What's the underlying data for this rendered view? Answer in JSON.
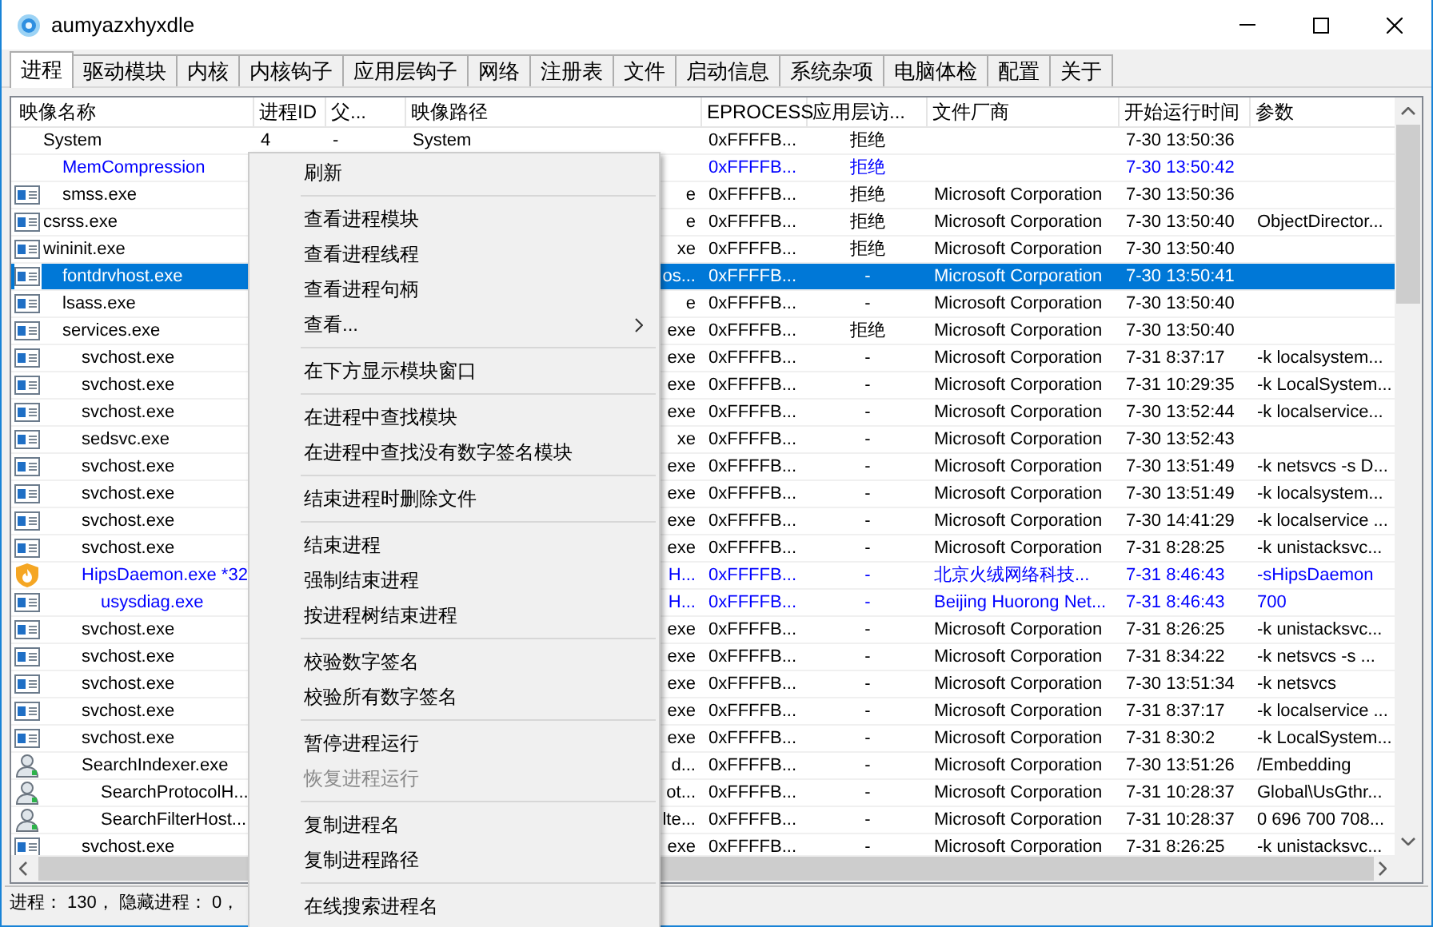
{
  "window": {
    "title": "aumyazxhyxdle"
  },
  "tabs": [
    {
      "label": "进程",
      "selected": true
    },
    {
      "label": "驱动模块",
      "selected": false
    },
    {
      "label": "内核",
      "selected": false
    },
    {
      "label": "内核钩子",
      "selected": false
    },
    {
      "label": "应用层钩子",
      "selected": false
    },
    {
      "label": "网络",
      "selected": false
    },
    {
      "label": "注册表",
      "selected": false
    },
    {
      "label": "文件",
      "selected": false
    },
    {
      "label": "启动信息",
      "selected": false
    },
    {
      "label": "系统杂项",
      "selected": false
    },
    {
      "label": "电脑体检",
      "selected": false
    },
    {
      "label": "配置",
      "selected": false
    },
    {
      "label": "关于",
      "selected": false
    }
  ],
  "table": {
    "columns": [
      "映像名称",
      "进程ID",
      "父...",
      "映像路径",
      "EPROCESS",
      "应用层访...",
      "文件厂商",
      "开始运行时间",
      "参数"
    ],
    "rows": [
      {
        "name": "System",
        "kind": "none",
        "flagged": false,
        "selected": false,
        "pid": "4",
        "parent": "-",
        "path": "System",
        "eprocess": "0xFFFFB...",
        "access": "拒绝",
        "start_time": "7-30 13:50:36",
        "children": [
          {
            "name": "MemCompression",
            "kind": "none",
            "flagged": true,
            "selected": false,
            "eprocess": "0xFFFFB...",
            "access": "拒绝",
            "start_time": "7-30 13:50:42"
          },
          {
            "name": "smss.exe",
            "kind": "window",
            "flagged": false,
            "selected": false,
            "path_tail": "e",
            "eprocess": "0xFFFFB...",
            "access": "拒绝",
            "vendor": "Microsoft Corporation",
            "start_time": "7-30 13:50:36"
          }
        ]
      },
      {
        "name": "csrss.exe",
        "kind": "window",
        "flagged": false,
        "selected": false,
        "path_tail": "e",
        "eprocess": "0xFFFFB...",
        "access": "拒绝",
        "vendor": "Microsoft Corporation",
        "start_time": "7-30 13:50:40",
        "args": "ObjectDirector..."
      },
      {
        "name": "wininit.exe",
        "kind": "window",
        "flagged": false,
        "selected": false,
        "path_tail": "xe",
        "eprocess": "0xFFFFB...",
        "access": "拒绝",
        "vendor": "Microsoft Corporation",
        "start_time": "7-30 13:50:40",
        "children": [
          {
            "name": "fontdrvhost.exe",
            "kind": "window",
            "flagged": false,
            "selected": true,
            "path_tail": "os...",
            "eprocess": "0xFFFFB...",
            "access": "-",
            "vendor": "Microsoft Corporation",
            "start_time": "7-30 13:50:41"
          },
          {
            "name": "lsass.exe",
            "kind": "window",
            "flagged": false,
            "selected": false,
            "path_tail": "e",
            "eprocess": "0xFFFFB...",
            "access": "-",
            "vendor": "Microsoft Corporation",
            "start_time": "7-30 13:50:40"
          },
          {
            "name": "services.exe",
            "kind": "window",
            "flagged": false,
            "selected": false,
            "path_tail": "exe",
            "eprocess": "0xFFFFB...",
            "access": "拒绝",
            "vendor": "Microsoft Corporation",
            "start_time": "7-30 13:50:40",
            "children": [
              {
                "name": "svchost.exe",
                "kind": "window",
                "flagged": false,
                "selected": false,
                "path_tail": "exe",
                "eprocess": "0xFFFFB...",
                "access": "-",
                "vendor": "Microsoft Corporation",
                "start_time": "7-31 8:37:17",
                "args": "-k localsystem..."
              },
              {
                "name": "svchost.exe",
                "kind": "window",
                "flagged": false,
                "selected": false,
                "path_tail": "exe",
                "eprocess": "0xFFFFB...",
                "access": "-",
                "vendor": "Microsoft Corporation",
                "start_time": "7-31 10:29:35",
                "args": "-k LocalSystem..."
              },
              {
                "name": "svchost.exe",
                "kind": "window",
                "flagged": false,
                "selected": false,
                "path_tail": "exe",
                "eprocess": "0xFFFFB...",
                "access": "-",
                "vendor": "Microsoft Corporation",
                "start_time": "7-30 13:52:44",
                "args": "-k localservice..."
              },
              {
                "name": "sedsvc.exe",
                "kind": "window",
                "flagged": false,
                "selected": false,
                "path_tail": "xe",
                "eprocess": "0xFFFFB...",
                "access": "-",
                "vendor": "Microsoft Corporation",
                "start_time": "7-30 13:52:43"
              },
              {
                "name": "svchost.exe",
                "kind": "window",
                "flagged": false,
                "selected": false,
                "path_tail": "exe",
                "eprocess": "0xFFFFB...",
                "access": "-",
                "vendor": "Microsoft Corporation",
                "start_time": "7-30 13:51:49",
                "args": "-k netsvcs -s D..."
              },
              {
                "name": "svchost.exe",
                "kind": "window",
                "flagged": false,
                "selected": false,
                "path_tail": "exe",
                "eprocess": "0xFFFFB...",
                "access": "-",
                "vendor": "Microsoft Corporation",
                "start_time": "7-30 13:51:49",
                "args": "-k localsystem..."
              },
              {
                "name": "svchost.exe",
                "kind": "window",
                "flagged": false,
                "selected": false,
                "path_tail": "exe",
                "eprocess": "0xFFFFB...",
                "access": "-",
                "vendor": "Microsoft Corporation",
                "start_time": "7-30 14:41:29",
                "args": "-k localservice ..."
              },
              {
                "name": "svchost.exe",
                "kind": "window",
                "flagged": false,
                "selected": false,
                "path_tail": "exe",
                "eprocess": "0xFFFFB...",
                "access": "-",
                "vendor": "Microsoft Corporation",
                "start_time": "7-31 8:28:25",
                "args": "-k unistacksvc..."
              },
              {
                "name": "HipsDaemon.exe *32",
                "kind": "shield",
                "flagged": true,
                "selected": false,
                "path_tail": "H...",
                "eprocess": "0xFFFFB...",
                "access": "-",
                "vendor": "北京火绒网络科技...",
                "start_time": "7-31 8:46:43",
                "args": "-sHipsDaemon",
                "children": [
                  {
                    "name": "usysdiag.exe",
                    "kind": "window",
                    "flagged": true,
                    "selected": false,
                    "path_tail": "H...",
                    "eprocess": "0xFFFFB...",
                    "access": "-",
                    "vendor": "Beijing Huorong Net...",
                    "start_time": "7-31 8:46:43",
                    "args": "700"
                  }
                ]
              },
              {
                "name": "svchost.exe",
                "kind": "window",
                "flagged": false,
                "selected": false,
                "path_tail": "exe",
                "eprocess": "0xFFFFB...",
                "access": "-",
                "vendor": "Microsoft Corporation",
                "start_time": "7-31 8:26:25",
                "args": "-k unistacksvc..."
              },
              {
                "name": "svchost.exe",
                "kind": "window",
                "flagged": false,
                "selected": false,
                "path_tail": "exe",
                "eprocess": "0xFFFFB...",
                "access": "-",
                "vendor": "Microsoft Corporation",
                "start_time": "7-31 8:34:22",
                "args": "-k netsvcs -s ..."
              },
              {
                "name": "svchost.exe",
                "kind": "window",
                "flagged": false,
                "selected": false,
                "path_tail": "exe",
                "eprocess": "0xFFFFB...",
                "access": "-",
                "vendor": "Microsoft Corporation",
                "start_time": "7-30 13:51:34",
                "args": "-k netsvcs"
              },
              {
                "name": "svchost.exe",
                "kind": "window",
                "flagged": false,
                "selected": false,
                "path_tail": "exe",
                "eprocess": "0xFFFFB...",
                "access": "-",
                "vendor": "Microsoft Corporation",
                "start_time": "7-31 8:37:17",
                "args": "-k localservice ..."
              },
              {
                "name": "svchost.exe",
                "kind": "window",
                "flagged": false,
                "selected": false,
                "path_tail": "exe",
                "eprocess": "0xFFFFB...",
                "access": "-",
                "vendor": "Microsoft Corporation",
                "start_time": "7-31 8:30:2",
                "args": "-k LocalSystem..."
              },
              {
                "name": "SearchIndexer.exe",
                "kind": "search",
                "flagged": false,
                "selected": false,
                "path_tail": "d...",
                "eprocess": "0xFFFFB...",
                "access": "-",
                "vendor": "Microsoft Corporation",
                "start_time": "7-30 13:51:26",
                "args": "/Embedding",
                "children": [
                  {
                    "name": "SearchProtocolH...",
                    "kind": "search",
                    "flagged": false,
                    "selected": false,
                    "path_tail": "ot...",
                    "eprocess": "0xFFFFB...",
                    "access": "-",
                    "vendor": "Microsoft Corporation",
                    "start_time": "7-31 10:28:37",
                    "args": "Global\\UsGthr..."
                  },
                  {
                    "name": "SearchFilterHost...",
                    "kind": "search",
                    "flagged": false,
                    "selected": false,
                    "path_tail": "lte...",
                    "eprocess": "0xFFFFB...",
                    "access": "-",
                    "vendor": "Microsoft Corporation",
                    "start_time": "7-31 10:28:37",
                    "args": "0 696 700 708..."
                  }
                ]
              },
              {
                "name": "svchost.exe",
                "kind": "window",
                "flagged": false,
                "selected": false,
                "path_tail": "exe",
                "eprocess": "0xFFFFB...",
                "access": "-",
                "vendor": "Microsoft Corporation",
                "start_time": "7-31 8:26:25",
                "args": "-k unistacksvc..."
              }
            ]
          }
        ]
      }
    ]
  },
  "status_bar": "进程： 130， 隐藏进程： 0，",
  "context_menu": [
    {
      "kind": "item",
      "label": "刷新",
      "disabled": false,
      "submenu": false
    },
    {
      "kind": "separator"
    },
    {
      "kind": "item",
      "label": "查看进程模块",
      "disabled": false,
      "submenu": false
    },
    {
      "kind": "item",
      "label": "查看进程线程",
      "disabled": false,
      "submenu": false
    },
    {
      "kind": "item",
      "label": "查看进程句柄",
      "disabled": false,
      "submenu": false
    },
    {
      "kind": "item",
      "label": "查看...",
      "disabled": false,
      "submenu": true
    },
    {
      "kind": "separator"
    },
    {
      "kind": "item",
      "label": "在下方显示模块窗口",
      "disabled": false,
      "submenu": false
    },
    {
      "kind": "separator"
    },
    {
      "kind": "item",
      "label": "在进程中查找模块",
      "disabled": false,
      "submenu": false
    },
    {
      "kind": "item",
      "label": "在进程中查找没有数字签名模块",
      "disabled": false,
      "submenu": false
    },
    {
      "kind": "separator"
    },
    {
      "kind": "item",
      "label": "结束进程时删除文件",
      "disabled": false,
      "submenu": false
    },
    {
      "kind": "separator"
    },
    {
      "kind": "item",
      "label": "结束进程",
      "disabled": false,
      "submenu": false
    },
    {
      "kind": "item",
      "label": "强制结束进程",
      "disabled": false,
      "submenu": false
    },
    {
      "kind": "item",
      "label": "按进程树结束进程",
      "disabled": false,
      "submenu": false
    },
    {
      "kind": "separator"
    },
    {
      "kind": "item",
      "label": "校验数字签名",
      "disabled": false,
      "submenu": false
    },
    {
      "kind": "item",
      "label": "校验所有数字签名",
      "disabled": false,
      "submenu": false
    },
    {
      "kind": "separator"
    },
    {
      "kind": "item",
      "label": "暂停进程运行",
      "disabled": false,
      "submenu": false
    },
    {
      "kind": "item",
      "label": "恢复进程运行",
      "disabled": true,
      "submenu": false
    },
    {
      "kind": "separator"
    },
    {
      "kind": "item",
      "label": "复制进程名",
      "disabled": false,
      "submenu": false
    },
    {
      "kind": "item",
      "label": "复制进程路径",
      "disabled": false,
      "submenu": false
    },
    {
      "kind": "separator"
    },
    {
      "kind": "item",
      "label": "在线搜索进程名",
      "disabled": false,
      "submenu": false
    }
  ]
}
